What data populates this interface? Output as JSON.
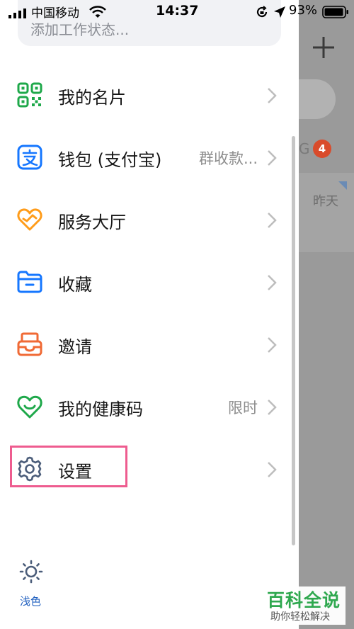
{
  "status_bar": {
    "carrier": "中国移动",
    "time": "14:37",
    "battery": "93%"
  },
  "drawer": {
    "work_status_placeholder": "添加工作状态...",
    "items": [
      {
        "label": "我的名片",
        "extra": "",
        "icon": "qr-code-icon"
      },
      {
        "label": "钱包 (支付宝)",
        "extra": "群收款...",
        "icon": "alipay-wallet-icon"
      },
      {
        "label": "服务大厅",
        "extra": "",
        "icon": "service-hall-icon"
      },
      {
        "label": "收藏",
        "extra": "",
        "icon": "folder-favorites-icon"
      },
      {
        "label": "邀请",
        "extra": "",
        "icon": "invite-inbox-icon"
      },
      {
        "label": "我的健康码",
        "extra": "限时",
        "icon": "health-heart-icon"
      },
      {
        "label": "设置",
        "extra": "",
        "icon": "gear-icon"
      }
    ],
    "theme_label": "浅色"
  },
  "underlay": {
    "group_letter": "G",
    "badge": "4",
    "date_label": "昨天"
  },
  "watermark": {
    "title": "百科全说",
    "subtitle": "助你轻松解决"
  },
  "colors": {
    "green": "#1ea84a",
    "blue": "#1677ff",
    "orange": "#ff9c1a",
    "red_orange": "#f06a35",
    "highlight": "#ee5c8f"
  }
}
